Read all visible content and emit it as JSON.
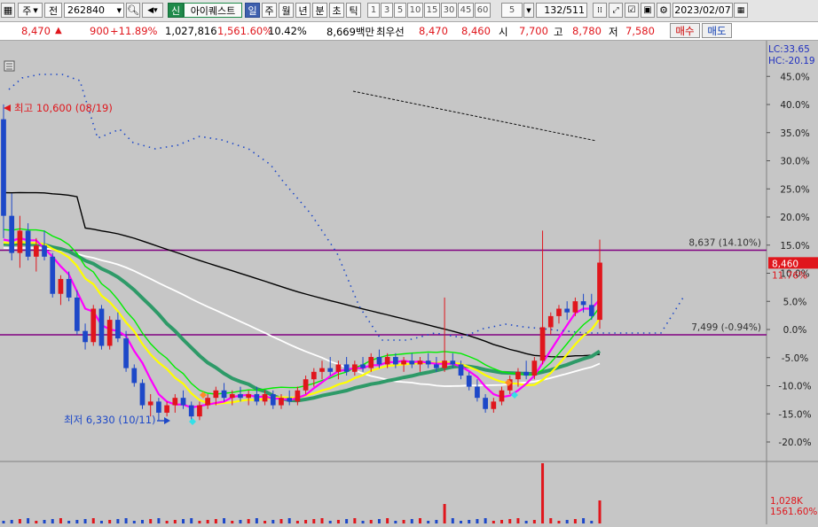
{
  "toolbar": {
    "exchange_label": "주",
    "prev_label": "전",
    "code": "262840",
    "buy_mode": "신",
    "stock_name": "아이퀘스트",
    "periods": [
      {
        "label": "일",
        "active": true
      },
      {
        "label": "주",
        "active": false
      },
      {
        "label": "월",
        "active": false
      },
      {
        "label": "년",
        "active": false
      },
      {
        "label": "분",
        "active": false
      },
      {
        "label": "초",
        "active": false
      },
      {
        "label": "틱",
        "active": false
      }
    ],
    "intervals": [
      "1",
      "3",
      "5",
      "10",
      "15",
      "30",
      "45",
      "60"
    ],
    "count": "5",
    "page": "132",
    "total": "/511",
    "date": "2023/02/07"
  },
  "info": {
    "price": "8,470",
    "change": "900",
    "change_pct": "+11.89%",
    "volume": "1,027,816",
    "volume_ratio": "1,561.60%",
    "turnover": "10.42%",
    "amount": "8,669백만",
    "best_ask_label": "최우선",
    "best_ask": "8,470",
    "best_bid": "8,460",
    "open_label": "시",
    "open": "7,700",
    "high_label": "고",
    "high": "8,780",
    "low_label": "저",
    "low": "7,580",
    "buy_label": "매수",
    "sell_label": "매도"
  },
  "colors": {
    "up": "#e0161c",
    "down": "#1d48c8",
    "ma5": "#ff00ff",
    "ma10": "#ffff00",
    "ma20": "#2e9a68",
    "ma60": "#ffffff",
    "ma120": "#000000",
    "envelope": "#00ee00",
    "guide": "#800080",
    "plot_bg": "#c6c6c6"
  },
  "chart_data": {
    "type": "candlestick",
    "right_axis": {
      "ticks": [
        "45.0%",
        "40.0%",
        "35.0%",
        "30.0%",
        "25.0%",
        "20.0%",
        "15.0%",
        "10.0%",
        "5.0%",
        "0.0%",
        "-5.0%",
        "-10.0%",
        "-15.0%",
        "-20.0%"
      ],
      "lc_label": "LC:33.65",
      "hc_label": "HC:-20.19",
      "current_price": "8,460",
      "current_pct": "11.76%"
    },
    "annotations": {
      "high": "최고 10,600 (08/19)",
      "low": "최저 6,330 (10/11)",
      "line_upper": "8,637 (14.10%)",
      "line_lower": "7,499 (-0.94%)"
    },
    "volume_axis": {
      "value": "1,028K",
      "pct": "1561.60%"
    },
    "candles": [
      {
        "o": 10400,
        "h": 10600,
        "l": 8800,
        "c": 9100
      },
      {
        "o": 9100,
        "h": 9400,
        "l": 8500,
        "c": 8600
      },
      {
        "o": 8600,
        "h": 9100,
        "l": 8400,
        "c": 8900
      },
      {
        "o": 8900,
        "h": 9000,
        "l": 8500,
        "c": 8550
      },
      {
        "o": 8550,
        "h": 8800,
        "l": 8350,
        "c": 8700
      },
      {
        "o": 8700,
        "h": 8900,
        "l": 8500,
        "c": 8550
      },
      {
        "o": 8550,
        "h": 8600,
        "l": 8000,
        "c": 8050
      },
      {
        "o": 8050,
        "h": 8300,
        "l": 7900,
        "c": 8250
      },
      {
        "o": 8250,
        "h": 8350,
        "l": 7950,
        "c": 8000
      },
      {
        "o": 8000,
        "h": 8100,
        "l": 7500,
        "c": 7550
      },
      {
        "o": 7550,
        "h": 7650,
        "l": 7300,
        "c": 7400
      },
      {
        "o": 7400,
        "h": 7900,
        "l": 7350,
        "c": 7850
      },
      {
        "o": 7850,
        "h": 7900,
        "l": 7300,
        "c": 7350
      },
      {
        "o": 7350,
        "h": 7750,
        "l": 7300,
        "c": 7700
      },
      {
        "o": 7700,
        "h": 7800,
        "l": 7400,
        "c": 7450
      },
      {
        "o": 7450,
        "h": 7550,
        "l": 7000,
        "c": 7050
      },
      {
        "o": 7050,
        "h": 7100,
        "l": 6800,
        "c": 6850
      },
      {
        "o": 6850,
        "h": 6900,
        "l": 6500,
        "c": 6550
      },
      {
        "o": 6550,
        "h": 6700,
        "l": 6400,
        "c": 6600
      },
      {
        "o": 6600,
        "h": 6650,
        "l": 6350,
        "c": 6450
      },
      {
        "o": 6450,
        "h": 6600,
        "l": 6400,
        "c": 6550
      },
      {
        "o": 6550,
        "h": 6700,
        "l": 6450,
        "c": 6650
      },
      {
        "o": 6650,
        "h": 6750,
        "l": 6500,
        "c": 6550
      },
      {
        "o": 6550,
        "h": 6600,
        "l": 6330,
        "c": 6400
      },
      {
        "o": 6400,
        "h": 6600,
        "l": 6350,
        "c": 6550
      },
      {
        "o": 6550,
        "h": 6700,
        "l": 6500,
        "c": 6650
      },
      {
        "o": 6650,
        "h": 6800,
        "l": 6550,
        "c": 6750
      },
      {
        "o": 6750,
        "h": 6850,
        "l": 6600,
        "c": 6650
      },
      {
        "o": 6650,
        "h": 6750,
        "l": 6550,
        "c": 6700
      },
      {
        "o": 6700,
        "h": 6800,
        "l": 6600,
        "c": 6650
      },
      {
        "o": 6650,
        "h": 6750,
        "l": 6550,
        "c": 6700
      },
      {
        "o": 6700,
        "h": 6800,
        "l": 6550,
        "c": 6600
      },
      {
        "o": 6600,
        "h": 6750,
        "l": 6550,
        "c": 6700
      },
      {
        "o": 6700,
        "h": 6750,
        "l": 6500,
        "c": 6550
      },
      {
        "o": 6550,
        "h": 6700,
        "l": 6500,
        "c": 6650
      },
      {
        "o": 6650,
        "h": 6750,
        "l": 6550,
        "c": 6600
      },
      {
        "o": 6600,
        "h": 6800,
        "l": 6550,
        "c": 6750
      },
      {
        "o": 6750,
        "h": 6950,
        "l": 6700,
        "c": 6900
      },
      {
        "o": 6900,
        "h": 7050,
        "l": 6800,
        "c": 7000
      },
      {
        "o": 7000,
        "h": 7150,
        "l": 6900,
        "c": 7050
      },
      {
        "o": 7050,
        "h": 7200,
        "l": 6950,
        "c": 7000
      },
      {
        "o": 7000,
        "h": 7150,
        "l": 6900,
        "c": 7100
      },
      {
        "o": 7100,
        "h": 7200,
        "l": 6950,
        "c": 7000
      },
      {
        "o": 7000,
        "h": 7150,
        "l": 6950,
        "c": 7100
      },
      {
        "o": 7100,
        "h": 7200,
        "l": 7000,
        "c": 7050
      },
      {
        "o": 7050,
        "h": 7250,
        "l": 7000,
        "c": 7200
      },
      {
        "o": 7200,
        "h": 7300,
        "l": 7050,
        "c": 7100
      },
      {
        "o": 7100,
        "h": 7250,
        "l": 7050,
        "c": 7200
      },
      {
        "o": 7200,
        "h": 7250,
        "l": 7050,
        "c": 7100
      },
      {
        "o": 7100,
        "h": 7200,
        "l": 7000,
        "c": 7150
      },
      {
        "o": 7150,
        "h": 7250,
        "l": 7050,
        "c": 7100
      },
      {
        "o": 7100,
        "h": 7200,
        "l": 7000,
        "c": 7150
      },
      {
        "o": 7150,
        "h": 7250,
        "l": 7050,
        "c": 7100
      },
      {
        "o": 7100,
        "h": 7200,
        "l": 7000,
        "c": 7050
      },
      {
        "o": 7050,
        "h": 8000,
        "l": 7000,
        "c": 7150
      },
      {
        "o": 7150,
        "h": 7250,
        "l": 7050,
        "c": 7100
      },
      {
        "o": 7100,
        "h": 7150,
        "l": 6900,
        "c": 6950
      },
      {
        "o": 6950,
        "h": 7000,
        "l": 6750,
        "c": 6800
      },
      {
        "o": 6800,
        "h": 6900,
        "l": 6600,
        "c": 6650
      },
      {
        "o": 6650,
        "h": 6700,
        "l": 6450,
        "c": 6500
      },
      {
        "o": 6500,
        "h": 6650,
        "l": 6450,
        "c": 6600
      },
      {
        "o": 6600,
        "h": 6800,
        "l": 6550,
        "c": 6750
      },
      {
        "o": 6750,
        "h": 6950,
        "l": 6700,
        "c": 6900
      },
      {
        "o": 6900,
        "h": 7050,
        "l": 6800,
        "c": 7000
      },
      {
        "o": 7000,
        "h": 7150,
        "l": 6900,
        "c": 6950
      },
      {
        "o": 6950,
        "h": 7200,
        "l": 6900,
        "c": 7150
      },
      {
        "o": 7150,
        "h": 8900,
        "l": 7100,
        "c": 7600
      },
      {
        "o": 7600,
        "h": 7800,
        "l": 7500,
        "c": 7750
      },
      {
        "o": 7750,
        "h": 7900,
        "l": 7650,
        "c": 7850
      },
      {
        "o": 7850,
        "h": 7950,
        "l": 7700,
        "c": 7800
      },
      {
        "o": 7800,
        "h": 8000,
        "l": 7750,
        "c": 7950
      },
      {
        "o": 7950,
        "h": 8050,
        "l": 7800,
        "c": 7900
      },
      {
        "o": 7900,
        "h": 8050,
        "l": 7700,
        "c": 7750
      },
      {
        "o": 7700,
        "h": 8780,
        "l": 7580,
        "c": 8470
      }
    ]
  }
}
